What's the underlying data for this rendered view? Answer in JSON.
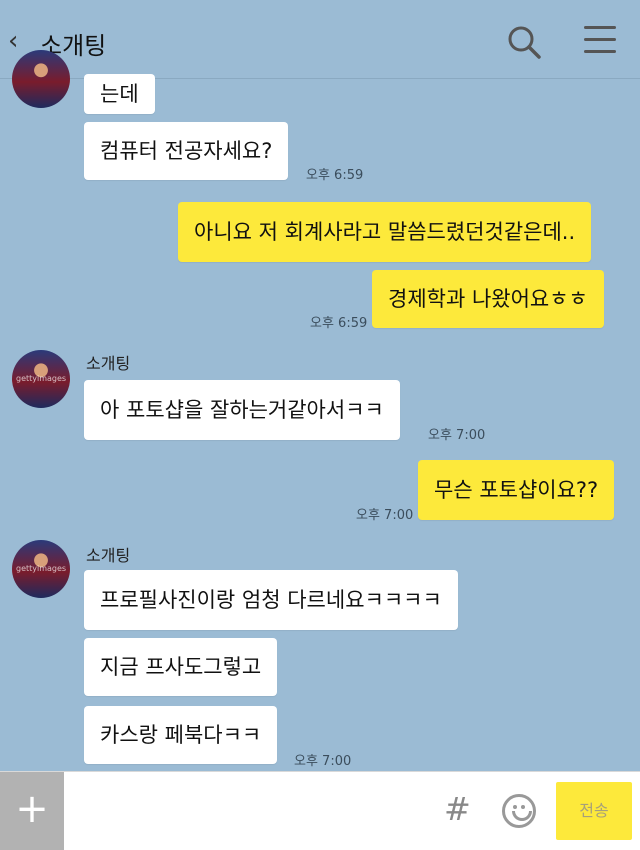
{
  "header": {
    "back_icon": "chevron-left-icon",
    "title": "소개팅",
    "search_icon": "search-icon",
    "menu_icon": "hamburger-menu-icon"
  },
  "messages": [
    {
      "from": "other",
      "text": "는데"
    },
    {
      "from": "other",
      "text": "컴퓨터 전공자세요?",
      "time": "오후 6:59"
    },
    {
      "from": "me",
      "text": "아니요 저 회계사라고 말씀드렸던것같은데.."
    },
    {
      "from": "me",
      "text": "경제학과 나왔어요ㅎㅎ",
      "time": "오후 6:59"
    },
    {
      "from": "other",
      "sender": "소개팅",
      "text": "아 포토샵을 잘하는거같아서ㅋㅋ",
      "time": "오후 7:00"
    },
    {
      "from": "me",
      "text": "무슨 포토샵이요??",
      "time": "오후 7:00"
    },
    {
      "from": "other",
      "sender": "소개팅",
      "text": "프로필사진이랑 엄청 다르네요ㅋㅋㅋㅋ"
    },
    {
      "from": "other",
      "text": "지금 프사도그렇고"
    },
    {
      "from": "other",
      "text": "카스랑 페북다ㅋㅋ",
      "time": "오후 7:00"
    }
  ],
  "avatar_watermark": "gettyimages",
  "input": {
    "plus_label": "+",
    "hash_label": "#",
    "emoji_icon": "emoji-icon",
    "send_label": "전송"
  },
  "colors": {
    "background": "#9bbbd4",
    "my_bubble": "#fde93b",
    "other_bubble": "#ffffff"
  }
}
